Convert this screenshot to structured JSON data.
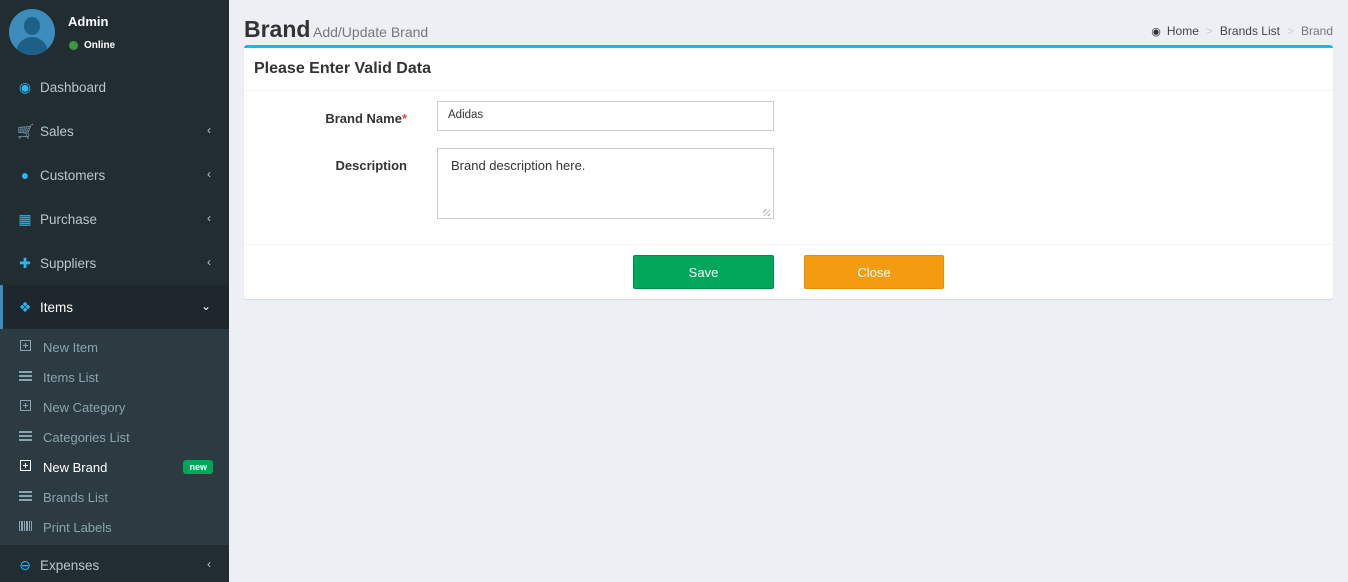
{
  "user": {
    "name": "Admin",
    "status": "Online"
  },
  "sidebar": {
    "items": [
      {
        "label": "Dashboard",
        "icon": "dashboard-icon"
      },
      {
        "label": "Sales",
        "icon": "cart-icon"
      },
      {
        "label": "Customers",
        "icon": "users-icon"
      },
      {
        "label": "Purchase",
        "icon": "grid-icon"
      },
      {
        "label": "Suppliers",
        "icon": "user-plus-icon"
      },
      {
        "label": "Items",
        "icon": "cubes-icon"
      },
      {
        "label": "Expenses",
        "icon": "minus-circle-icon"
      }
    ],
    "subitems": [
      {
        "label": "New Item"
      },
      {
        "label": "Items List"
      },
      {
        "label": "New Category"
      },
      {
        "label": "Categories List"
      },
      {
        "label": "New Brand",
        "badge": "new"
      },
      {
        "label": "Brands List"
      },
      {
        "label": "Print Labels"
      }
    ]
  },
  "header": {
    "title": "Brand",
    "subtitle": "Add/Update Brand",
    "breadcrumb": [
      "Home",
      "Brands List",
      "Brand"
    ]
  },
  "form": {
    "box_title": "Please Enter Valid Data",
    "brand_name_label": "Brand Name",
    "required_mark": "*",
    "brand_name_value": "Adidas",
    "description_label": "Description",
    "description_value": "Brand description  here.",
    "save_label": "Save",
    "close_label": "Close"
  },
  "colors": {
    "sidebar_bg": "#222d32",
    "accent": "#00c0ef",
    "save": "#00a65a",
    "close": "#f39c12",
    "badge": "#00a65a"
  }
}
